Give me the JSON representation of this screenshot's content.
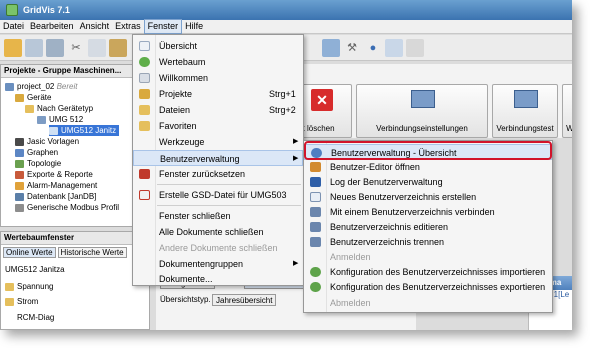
{
  "window": {
    "title": "GridVis 7.1"
  },
  "menubar": {
    "items": [
      {
        "label": "Datei"
      },
      {
        "label": "Bearbeiten"
      },
      {
        "label": "Ansicht"
      },
      {
        "label": "Extras"
      },
      {
        "label": "Fenster"
      },
      {
        "label": "Hilfe"
      }
    ]
  },
  "projects_panel": {
    "header": "Projekte - Gruppe Maschinen...",
    "tree": [
      {
        "label": "project_02",
        "extra": "Bereit"
      },
      {
        "label": "Geräte"
      },
      {
        "label": "Nach Gerätetyp"
      },
      {
        "label": "UMG 512"
      },
      {
        "label": "UMG512 Janitz"
      },
      {
        "label": "Jasic Vorlagen"
      },
      {
        "label": "Graphen"
      },
      {
        "label": "Topologie"
      },
      {
        "label": "Exporte & Reporte"
      },
      {
        "label": "Alarm-Management"
      },
      {
        "label": "Datenbank [JanDB]"
      },
      {
        "label": "Generische Modbus Profil"
      }
    ]
  },
  "values_panel": {
    "header": "Wertebaumfenster",
    "tabs": [
      {
        "label": "Online Werte"
      },
      {
        "label": "Historische Werte"
      }
    ],
    "device": "UMG512 Janitza",
    "items": [
      {
        "label": "Spannung"
      },
      {
        "label": "Strom"
      },
      {
        "label": "RCM-Diag"
      }
    ]
  },
  "device_buttons": [
    {
      "label": "rät löschen"
    },
    {
      "label": "Verbindungseinstellungen"
    },
    {
      "label": "Verbindungstest"
    },
    {
      "label": "We"
    }
  ],
  "middle_panel": {
    "energy_tab": "Energiewerte",
    "minmax_tab": "Min/Max Werte",
    "overview_label": "Übersichtstyp.",
    "year_button": "Jahresübersicht"
  },
  "info_panel": {
    "header": "Informa",
    "line1": "ramm 1[Le",
    "line2": "Prog"
  },
  "fenster_menu": {
    "items": [
      {
        "label": "Übersicht",
        "icon": "overview-icon"
      },
      {
        "label": "Wertebaum",
        "icon": "tree-icon"
      },
      {
        "label": "Willkommen",
        "icon": "welcome-icon"
      },
      {
        "label": "Projekte",
        "shortcut": "Strg+1",
        "icon": "projects-icon"
      },
      {
        "label": "Dateien",
        "shortcut": "Strg+2",
        "icon": "files-icon"
      },
      {
        "label": "Favoriten",
        "icon": "favorites-icon"
      },
      {
        "label": "Werkzeuge",
        "submenu": true
      },
      {
        "label": "Benutzerverwaltung",
        "submenu": true,
        "highlighted": true
      },
      {
        "label": "Fenster zurücksetzen",
        "icon": "reset-window-icon"
      },
      {
        "label": "Erstelle GSD-Datei für UMG503",
        "icon": "gsd-file-icon"
      },
      {
        "label": "Fenster schließen"
      },
      {
        "label": "Alle Dokumente schließen"
      },
      {
        "label": "Andere Dokumente schließen",
        "disabled": true
      },
      {
        "label": "Dokumentengruppen",
        "submenu": true
      },
      {
        "label": "Dokumente..."
      }
    ]
  },
  "user_menu": {
    "items": [
      {
        "label": "Benutzerverwaltung - Übersicht",
        "icon": "user-overview-icon",
        "highlighted": true
      },
      {
        "label": "Benutzer-Editor öffnen",
        "icon": "user-editor-icon"
      },
      {
        "label": "Log der Benutzerverwaltung",
        "icon": "log-icon"
      },
      {
        "label": "Neues Benutzerverzeichnis erstellen",
        "icon": "new-directory-icon"
      },
      {
        "label": "Mit einem Benutzerverzeichnis verbinden",
        "icon": "connect-directory-icon"
      },
      {
        "label": "Benutzerverzeichnis editieren",
        "icon": "edit-directory-icon"
      },
      {
        "label": "Benutzerverzeichnis trennen",
        "icon": "disconnect-directory-icon"
      },
      {
        "label": "Anmelden",
        "disabled": true
      },
      {
        "label": "Konfiguration des Benutzerverzeichnisses importieren",
        "icon": "import-icon"
      },
      {
        "label": "Konfiguration des Benutzerverzeichnisses exportieren",
        "icon": "export-icon"
      },
      {
        "label": "Abmelden",
        "disabled": true
      }
    ]
  },
  "colors": {
    "highlight_border": "#d1132a",
    "selection": "#3875d7",
    "title_bar": "#3b73b0"
  }
}
